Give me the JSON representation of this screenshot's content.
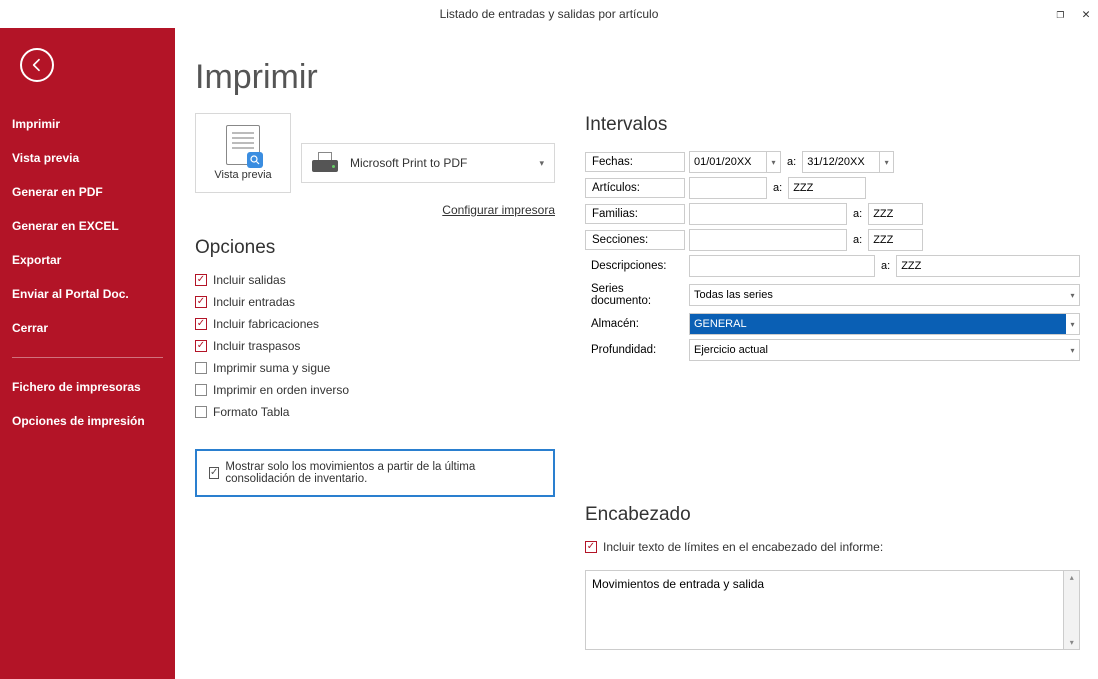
{
  "window": {
    "title": "Listado de entradas y salidas por artículo"
  },
  "sidebar": {
    "items": [
      "Imprimir",
      "Vista previa",
      "Generar en PDF",
      "Generar en EXCEL",
      "Exportar",
      "Enviar al Portal Doc.",
      "Cerrar"
    ],
    "items2": [
      "Fichero de impresoras",
      "Opciones de impresión"
    ]
  },
  "page": {
    "heading": "Imprimir",
    "preview_label": "Vista previa",
    "printer_name": "Microsoft Print to PDF",
    "config_link": "Configurar impresora"
  },
  "opciones": {
    "heading": "Opciones",
    "items": [
      {
        "label": "Incluir salidas",
        "checked": true
      },
      {
        "label": "Incluir entradas",
        "checked": true
      },
      {
        "label": "Incluir fabricaciones",
        "checked": true
      },
      {
        "label": "Incluir traspasos",
        "checked": true
      },
      {
        "label": "Imprimir suma y sigue",
        "checked": false
      },
      {
        "label": "Imprimir en orden inverso",
        "checked": false
      },
      {
        "label": "Formato Tabla",
        "checked": false
      }
    ],
    "highlight": {
      "label": "Mostrar solo los movimientos a partir de la última consolidación de inventario.",
      "checked": true
    }
  },
  "intervalos": {
    "heading": "Intervalos",
    "fechas": {
      "label": "Fechas:",
      "from": "01/01/20XX",
      "to": "31/12/20XX",
      "a": "a:"
    },
    "articulos": {
      "label": "Artículos:",
      "from": "",
      "to": "ZZZ",
      "a": "a:"
    },
    "familias": {
      "label": "Familias:",
      "from": "",
      "to": "ZZZ",
      "a": "a:"
    },
    "secciones": {
      "label": "Secciones:",
      "from": "",
      "to": "ZZZ",
      "a": "a:"
    },
    "descripciones": {
      "label": "Descripciones:",
      "from": "",
      "to": "ZZZ",
      "a": "a:"
    },
    "series": {
      "label": "Series documento:",
      "value": "Todas las series"
    },
    "almacen": {
      "label": "Almacén:",
      "value": "GENERAL"
    },
    "profundidad": {
      "label": "Profundidad:",
      "value": "Ejercicio actual"
    }
  },
  "encabezado": {
    "heading": "Encabezado",
    "check": {
      "label": "Incluir texto de límites en el encabezado del informe:",
      "checked": true
    },
    "text": "Movimientos de entrada y salida"
  }
}
